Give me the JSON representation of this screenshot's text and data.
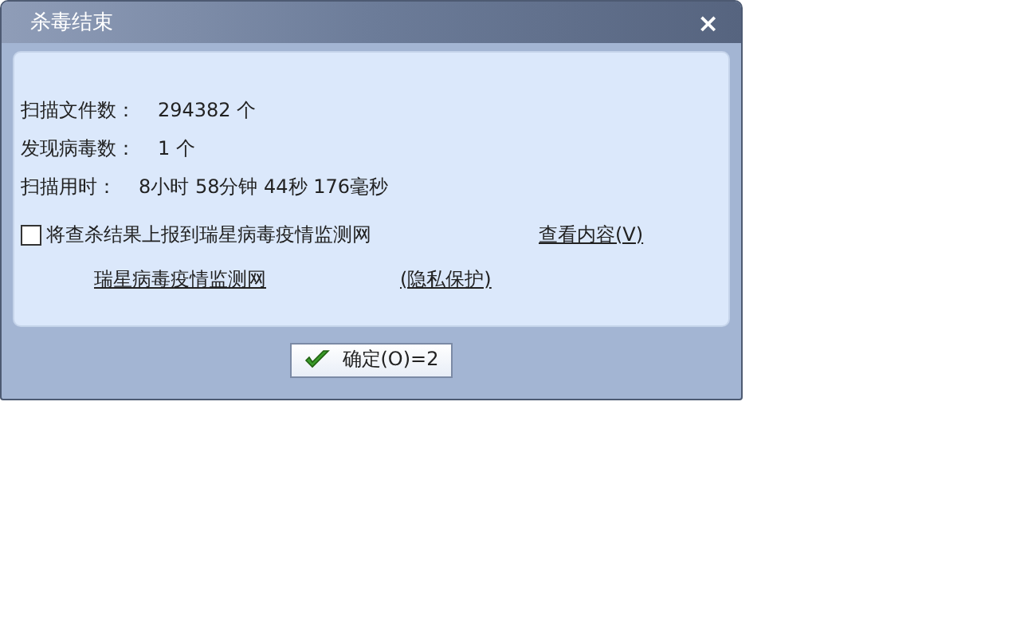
{
  "window": {
    "title": "杀毒结束",
    "close": "×"
  },
  "stats": [
    {
      "label": "扫描文件数：",
      "value": "294382 个"
    },
    {
      "label": "发现病毒数：",
      "value": "1 个"
    },
    {
      "label": "扫描用时：",
      "value": "8小时 58分钟 44秒 176毫秒"
    }
  ],
  "report": {
    "label": "将查杀结果上报到瑞星病毒疫情监测网",
    "checked": false
  },
  "links": [
    "查看内容(V)",
    "瑞星病毒疫情监测网",
    "(隐私保护)"
  ],
  "ok_button": {
    "label": "确定(O)=2"
  }
}
